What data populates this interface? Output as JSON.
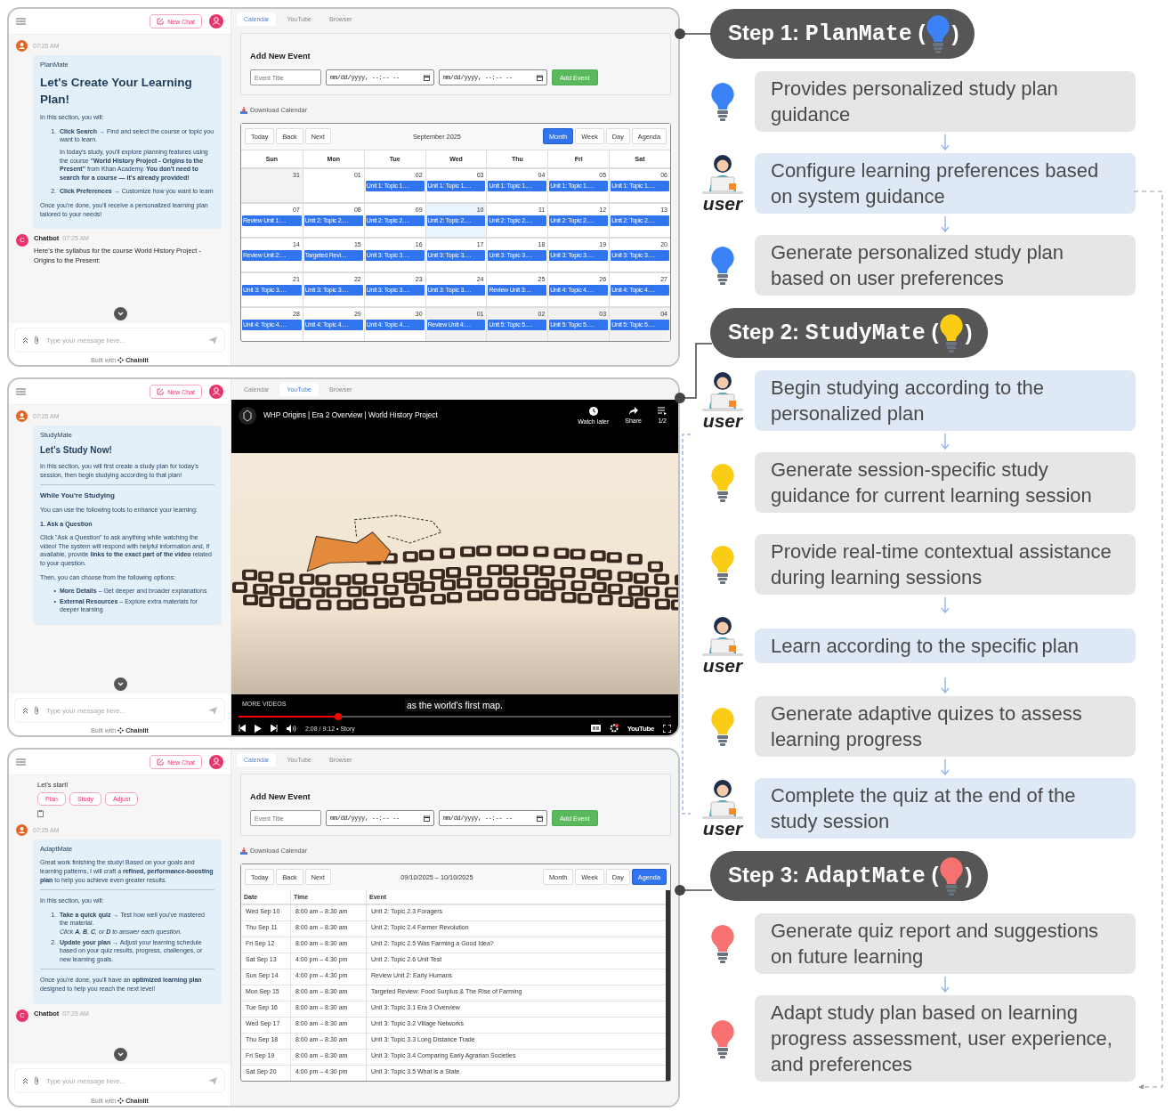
{
  "panels": [
    {
      "chat": {
        "new_chat": "New Chat",
        "messages": [
          {
            "kind": "card",
            "time": "07:25 AM",
            "label": "PlanMate",
            "heading": "Let's Create Your Learning Plan!",
            "blocks": [
              {
                "kind": "p",
                "text": "In this section, you will:"
              },
              {
                "kind": "ol",
                "items": [
                  {
                    "num": "1.",
                    "text": "**Click Search** → Find and select the course or topic you want to learn.",
                    "note": {
                      "text": "In today's study, you'll explore planning features using the course **\"World History Project - Origins to the Present\"** from Khan Academy. **You don't need to search for a course — it's already provided!**",
                      "italic": false
                    }
                  },
                  {
                    "num": "2.",
                    "text": "**Click Preferences** → Customize how you want to learn"
                  }
                ]
              },
              {
                "kind": "p",
                "text": "Once you're done, you'll receive a personalized learning plan tailored to your needs!"
              }
            ]
          },
          {
            "kind": "bot",
            "initial": "C",
            "name": "Chatbot",
            "time": "07:25 AM",
            "text": "Here's the syllabus for the course World History Project - Origins to the Present:"
          }
        ],
        "scroll_button": true,
        "placeholder": "Type your message here...",
        "footer": "Built with",
        "brand": "Chainlit"
      },
      "workspace": {
        "tabs": [
          {
            "label": "Calendar",
            "selected": true
          },
          {
            "label": "YouTube",
            "selected": false
          },
          {
            "label": "Browser",
            "selected": false
          }
        ],
        "kind": "calendar",
        "calendar": {
          "add_event": {
            "heading": "Add New Event",
            "title_placeholder": "Event Title",
            "start_placeholder": "mm/dd/yyyy, --:-- --",
            "end_placeholder": "mm/dd/yyyy, --:-- --",
            "button": "Add Event"
          },
          "download": "Download Calendar",
          "nav": [
            "Today",
            "Back",
            "Next"
          ],
          "range": "September 2025",
          "views": [
            {
              "label": "Month",
              "selected": true
            },
            {
              "label": "Week",
              "selected": false
            },
            {
              "label": "Day",
              "selected": false
            },
            {
              "label": "Agenda",
              "selected": false
            }
          ],
          "weekdays": [
            "Sun",
            "Mon",
            "Tue",
            "Wed",
            "Thu",
            "Fri",
            "Sat"
          ],
          "weeks": [
            {
              "days": [
                {
                  "date": "31",
                  "outside": true,
                  "today": false
                },
                {
                  "date": "01",
                  "outside": false,
                  "today": false
                },
                {
                  "date": "02",
                  "outside": false,
                  "today": false,
                  "event": "Unit 1: Topic 1.…"
                },
                {
                  "date": "03",
                  "outside": false,
                  "today": false,
                  "event": "Unit 1: Topic 1.…"
                },
                {
                  "date": "04",
                  "outside": false,
                  "today": false,
                  "event": "Unit 1: Topic 1.…"
                },
                {
                  "date": "05",
                  "outside": false,
                  "today": false,
                  "event": "Unit 1: Topic 1.…"
                },
                {
                  "date": "06",
                  "outside": false,
                  "today": false,
                  "event": "Unit 1: Topic 1.…"
                }
              ]
            },
            {
              "days": [
                {
                  "date": "07",
                  "outside": false,
                  "today": false,
                  "event": "Review Unit 1:…"
                },
                {
                  "date": "08",
                  "outside": false,
                  "today": false,
                  "event": "Unit 2: Topic 2.…"
                },
                {
                  "date": "09",
                  "outside": false,
                  "today": false,
                  "event": "Unit 2: Topic 2.…"
                },
                {
                  "date": "10",
                  "outside": false,
                  "today": true,
                  "event": "Unit 2: Topic 2.…"
                },
                {
                  "date": "11",
                  "outside": false,
                  "today": false,
                  "event": "Unit 2: Topic 2.…"
                },
                {
                  "date": "12",
                  "outside": false,
                  "today": false,
                  "event": "Unit 2: Topic 2.…"
                },
                {
                  "date": "13",
                  "outside": false,
                  "today": false,
                  "event": "Unit 2: Topic 2.…"
                }
              ]
            },
            {
              "days": [
                {
                  "date": "14",
                  "outside": false,
                  "today": false,
                  "event": "Review Unit 2:…"
                },
                {
                  "date": "15",
                  "outside": false,
                  "today": false,
                  "event": "Targeted Revi…"
                },
                {
                  "date": "16",
                  "outside": false,
                  "today": false,
                  "event": "Unit 3: Topic 3.…"
                },
                {
                  "date": "17",
                  "outside": false,
                  "today": false,
                  "event": "Unit 3: Topic 3.…"
                },
                {
                  "date": "18",
                  "outside": false,
                  "today": false,
                  "event": "Unit 3: Topic 3.…"
                },
                {
                  "date": "19",
                  "outside": false,
                  "today": false,
                  "event": "Unit 3: Topic 3.…"
                },
                {
                  "date": "20",
                  "outside": false,
                  "today": false,
                  "event": "Unit 3: Topic 3.…"
                }
              ]
            },
            {
              "days": [
                {
                  "date": "21",
                  "outside": false,
                  "today": false,
                  "event": "Unit 3: Topic 3.…"
                },
                {
                  "date": "22",
                  "outside": false,
                  "today": false,
                  "event": "Unit 3: Topic 3.…"
                },
                {
                  "date": "23",
                  "outside": false,
                  "today": false,
                  "event": "Unit 3: Topic 3.…"
                },
                {
                  "date": "24",
                  "outside": false,
                  "today": false,
                  "event": "Unit 3: Topic 3.…"
                },
                {
                  "date": "25",
                  "outside": false,
                  "today": false,
                  "event": "Review Unit 3:…"
                },
                {
                  "date": "26",
                  "outside": false,
                  "today": false,
                  "event": "Unit 4: Topic 4.…"
                },
                {
                  "date": "27",
                  "outside": false,
                  "today": false,
                  "event": "Unit 4: Topic 4.…"
                }
              ]
            },
            {
              "days": [
                {
                  "date": "28",
                  "outside": false,
                  "today": false,
                  "event": "Unit 4: Topic 4.…"
                },
                {
                  "date": "29",
                  "outside": false,
                  "today": false,
                  "event": "Unit 4: Topic 4.…"
                },
                {
                  "date": "30",
                  "outside": false,
                  "today": false,
                  "event": "Unit 4: Topic 4.…"
                },
                {
                  "date": "01",
                  "outside": true,
                  "today": false,
                  "event": "Review Unit 4:…"
                },
                {
                  "date": "02",
                  "outside": true,
                  "today": false,
                  "event": "Unit 5: Topic 5.…"
                },
                {
                  "date": "03",
                  "outside": true,
                  "today": false,
                  "event": "Unit 5: Topic 5.…"
                },
                {
                  "date": "04",
                  "outside": true,
                  "today": false,
                  "event": "Unit 5: Topic 5.…"
                }
              ]
            }
          ]
        }
      }
    },
    {
      "chat": {
        "new_chat": "New Chat",
        "messages": [
          {
            "kind": "card",
            "time": "07:25 AM",
            "label": "StudyMate",
            "heading": "Let’s Study Now!",
            "blocks": [
              {
                "kind": "p",
                "text": "In this section, you will first create a study plan for today’s session, then begin studying according to that plan!"
              },
              {
                "kind": "hr"
              },
              {
                "kind": "h",
                "text": "While You're Studying"
              },
              {
                "kind": "p",
                "text": "You can use the following tools to enhance your learning:"
              },
              {
                "kind": "h4",
                "text": "1. Ask a Question"
              },
              {
                "kind": "p",
                "text": "Click \"Ask a Question\" to ask anything while watching the video! The system will respond with helpful information and, if available, provide **links to the exact part of the video** related to your question."
              },
              {
                "kind": "p",
                "text": "Then, you can choose from the following options:"
              },
              {
                "kind": "ul",
                "items": [
                  {
                    "num": "•",
                    "text": "**More Details** – Get deeper and broader explanations"
                  },
                  {
                    "num": "•",
                    "text": "**External Resources** – Explore extra materials for deeper learning"
                  }
                ]
              }
            ]
          }
        ],
        "scroll_button": true,
        "placeholder": "Type your message here...",
        "footer": "Built with",
        "brand": "Chainlit"
      },
      "workspace": {
        "tabs": [
          {
            "label": "Calendar",
            "selected": false
          },
          {
            "label": "YouTube",
            "selected": true
          },
          {
            "label": "Browser",
            "selected": false
          }
        ],
        "kind": "video",
        "video": {
          "title": "WHP Origins | Era 2 Overview | World History Project",
          "actions": [
            {
              "kind": "watch_later",
              "label": "Watch later"
            },
            {
              "kind": "share",
              "label": "Share"
            },
            {
              "kind": "playlist",
              "label": "1/2"
            }
          ],
          "more": "MORE VIDEOS",
          "caption": "as the world's first map.",
          "level": 0.23,
          "time": "2:08 / 9:12 • Story",
          "brand": "YouTube"
        }
      }
    },
    {
      "chat": {
        "new_chat": "New Chat",
        "messages": [
          {
            "kind": "start",
            "text": "Let's start!",
            "buttons": [
              "Plan",
              "Study",
              "Adjust"
            ]
          },
          {
            "kind": "card",
            "time": "07:25 AM",
            "label": "AdaptMate",
            "blocks": [
              {
                "kind": "p",
                "text": "Great work finishing the study! Based on your goals and learning patterns, I will craft a **refined, performance-boosting plan** to help you achieve even greater results."
              },
              {
                "kind": "hr"
              },
              {
                "kind": "p",
                "text": "In this section, you will:"
              },
              {
                "kind": "ol",
                "items": [
                  {
                    "num": "1.",
                    "text": "**Take a quick quiz** → Test how well you've mastered the material.",
                    "note": {
                      "text": "Click **A**, **B**, **C**, or **D** to answer each question.",
                      "italic": true
                    }
                  },
                  {
                    "num": "2.",
                    "text": "**Update your plan** → Adjust your learning schedule based on your quiz results, progress, challenges, or new learning goals."
                  }
                ]
              },
              {
                "kind": "hr"
              },
              {
                "kind": "p",
                "text": "Once you're done, you'll have an **optimized learning plan** designed to help you reach the next level!"
              }
            ]
          },
          {
            "kind": "bot",
            "initial": "C",
            "name": "Chatbot",
            "time": "07:25 AM"
          }
        ],
        "scroll_button": true,
        "placeholder": "Type your message here...",
        "footer": "Built with",
        "brand": "Chainlit"
      },
      "workspace": {
        "tabs": [
          {
            "label": "Calendar",
            "selected": true
          },
          {
            "label": "YouTube",
            "selected": false
          },
          {
            "label": "Browser",
            "selected": false
          }
        ],
        "kind": "calendar",
        "calendar": {
          "add_event": {
            "heading": "Add New Event",
            "title_placeholder": "Event Title",
            "start_placeholder": "mm/dd/yyyy, --:-- --",
            "end_placeholder": "mm/dd/yyyy, --:-- --",
            "button": "Add Event"
          },
          "download": "Download Calendar",
          "nav": [
            "Today",
            "Back",
            "Next"
          ],
          "range": "09/10/2025 – 10/10/2025",
          "views": [
            {
              "label": "Month",
              "selected": false
            },
            {
              "label": "Week",
              "selected": false
            },
            {
              "label": "Day",
              "selected": false
            },
            {
              "label": "Agenda",
              "selected": true
            }
          ],
          "agenda": {
            "columns": [
              "Date",
              "Time",
              "Event"
            ],
            "rows": [
              {
                "date": "Wed Sep 10",
                "time": "8:00 am – 8:30 am",
                "event": "Unit 2: Topic 2.3 Foragers"
              },
              {
                "date": "Thu Sep 11",
                "time": "8:00 am – 8:30 am",
                "event": "Unit 2: Topic 2.4 Farmer Revolution"
              },
              {
                "date": "Fri Sep 12",
                "time": "8:00 am – 8:30 am",
                "event": "Unit 2: Topic 2.5 Was Farming a Good Idea?"
              },
              {
                "date": "Sat Sep 13",
                "time": "4:00 pm – 4:30 pm",
                "event": "Unit 2: Topic 2.6 Unit Test"
              },
              {
                "date": "Sun Sep 14",
                "time": "4:00 pm – 4:30 pm",
                "event": "Review Unit 2: Early Humans"
              },
              {
                "date": "Mon Sep 15",
                "time": "8:00 am – 8:30 am",
                "event": "Targeted Review: Food Surplus & The Rise of Farming"
              },
              {
                "date": "Tue Sep 16",
                "time": "8:00 am – 8:30 am",
                "event": "Unit 3: Topic 3.1 Era 3 Overview"
              },
              {
                "date": "Wed Sep 17",
                "time": "8:00 am – 8:30 am",
                "event": "Unit 3: Topic 3.2 Village Networks"
              },
              {
                "date": "Thu Sep 18",
                "time": "8:00 am – 8:30 am",
                "event": "Unit 3: Topic 3.3 Long Distance Trade"
              },
              {
                "date": "Fri Sep 19",
                "time": "8:00 am – 8:30 am",
                "event": "Unit 3: Topic 3.4 Comparing Early Agrarian Societies"
              },
              {
                "date": "Sat Sep 20",
                "time": "4:00 pm – 4:30 pm",
                "event": "Unit 3: Topic 3.5 What is a State"
              }
            ]
          }
        }
      }
    }
  ],
  "steps": [
    {
      "step": "Step 1:",
      "name": "PlanMate",
      "open": "(",
      "close": ")",
      "color": "#3b82f6",
      "items": [
        {
          "kind": "system",
          "text": "Provides personalized study plan guidance",
          "arrow": true
        },
        {
          "kind": "user",
          "actor_label": "user",
          "text": "Configure learning preferences based on system guidance",
          "arrow": true
        },
        {
          "kind": "system",
          "text": "Generate personalized study plan based on user preferences"
        }
      ]
    },
    {
      "step": "Step 2:",
      "name": "StudyMate",
      "open": "(",
      "close": ")",
      "color": "#facc15",
      "items": [
        {
          "kind": "user",
          "actor_label": "user",
          "text": "Begin studying according to the personalized plan",
          "arrow": true
        },
        {
          "kind": "system",
          "text": "Generate session-specific study guidance for current learning session",
          "arrow": false
        },
        {
          "kind": "system",
          "text": "Provide real-time contextual assistance during learning sessions",
          "arrow": true
        },
        {
          "kind": "user",
          "actor_label": "user",
          "text": "Learn according to the specific plan",
          "arrow": true
        },
        {
          "kind": "system",
          "text": "Generate adaptive quizes to assess learning progress",
          "arrow": true
        },
        {
          "kind": "user",
          "actor_label": "user",
          "text": "Complete the quiz at the end of the study session"
        }
      ]
    },
    {
      "step": "Step 3:",
      "name": "AdaptMate",
      "open": "(",
      "close": ")",
      "color": "#f87171",
      "items": [
        {
          "kind": "system",
          "text": "Generate quiz report and suggestions on future learning",
          "arrow": true
        },
        {
          "kind": "system",
          "text": "Adapt study plan based on learning progress assessment, user experience, and preferences"
        }
      ]
    }
  ]
}
